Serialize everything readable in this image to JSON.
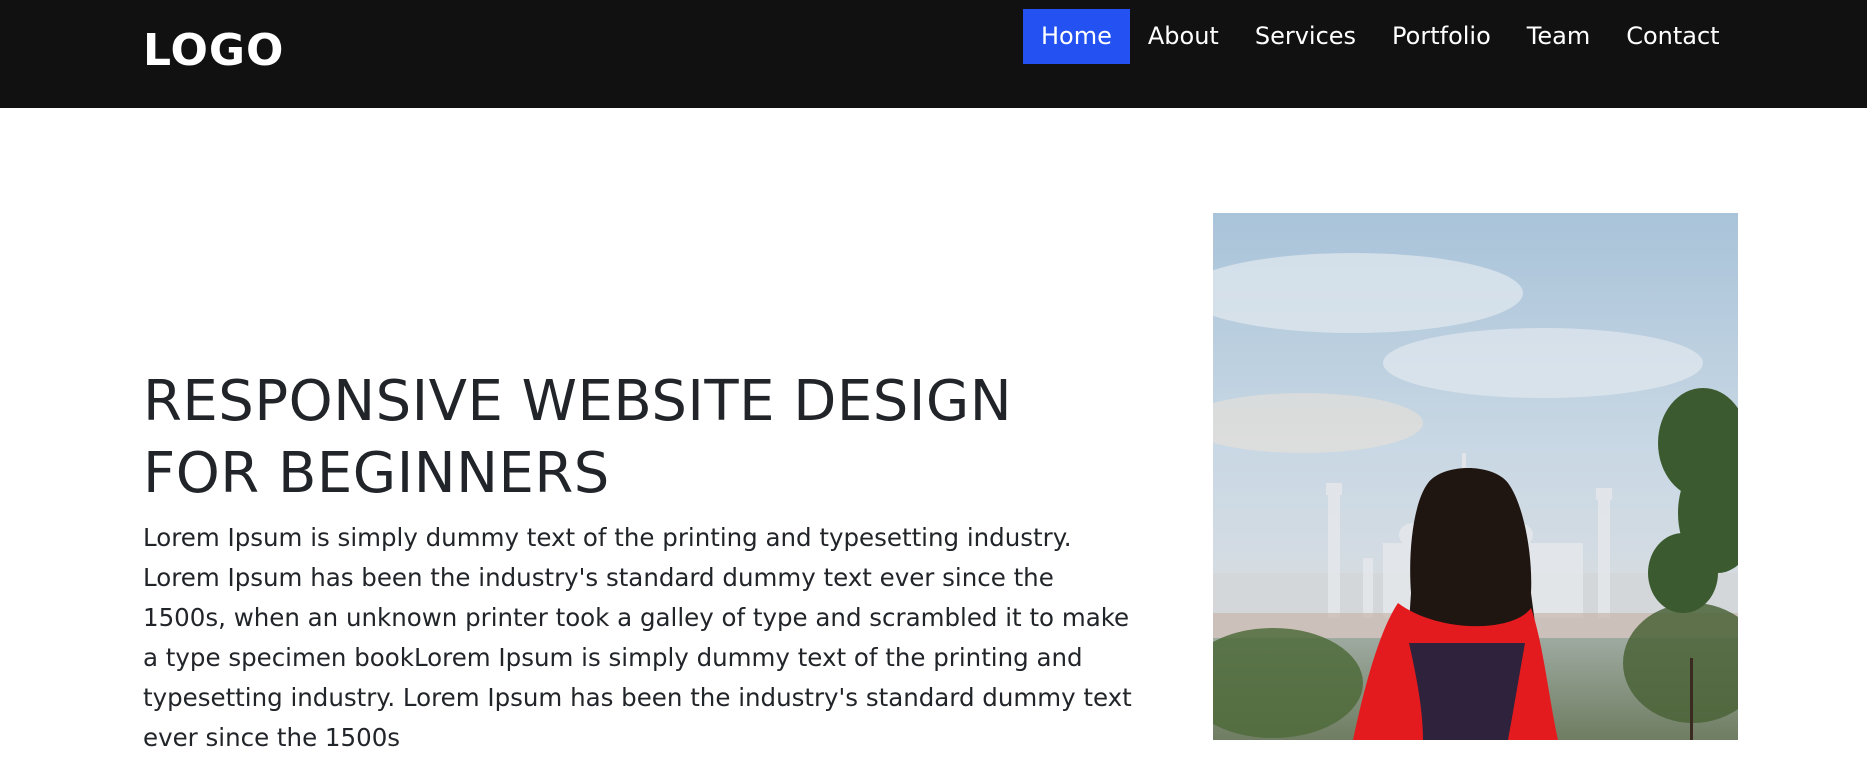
{
  "brand": {
    "logo_text": "LOGO"
  },
  "nav": {
    "items": [
      {
        "label": "Home",
        "active": true
      },
      {
        "label": "About",
        "active": false
      },
      {
        "label": "Services",
        "active": false
      },
      {
        "label": "Portfolio",
        "active": false
      },
      {
        "label": "Team",
        "active": false
      },
      {
        "label": "Contact",
        "active": false
      }
    ]
  },
  "hero": {
    "title": "RESPONSIVE WEBSITE DESIGN FOR BEGINNERS",
    "text": "Lorem Ipsum is simply dummy text of the printing and typesetting industry. Lorem Ipsum has been the industry's standard dummy text ever since the 1500s, when an unknown printer took a galley of type and scrambled it to make a type specimen bookLorem Ipsum is simply dummy text of the printing and typesetting industry. Lorem Ipsum has been the industry's standard dummy text ever since the 1500s"
  },
  "colors": {
    "navbar_bg": "#111111",
    "active_nav_bg": "#2451f2",
    "text": "#212529"
  }
}
